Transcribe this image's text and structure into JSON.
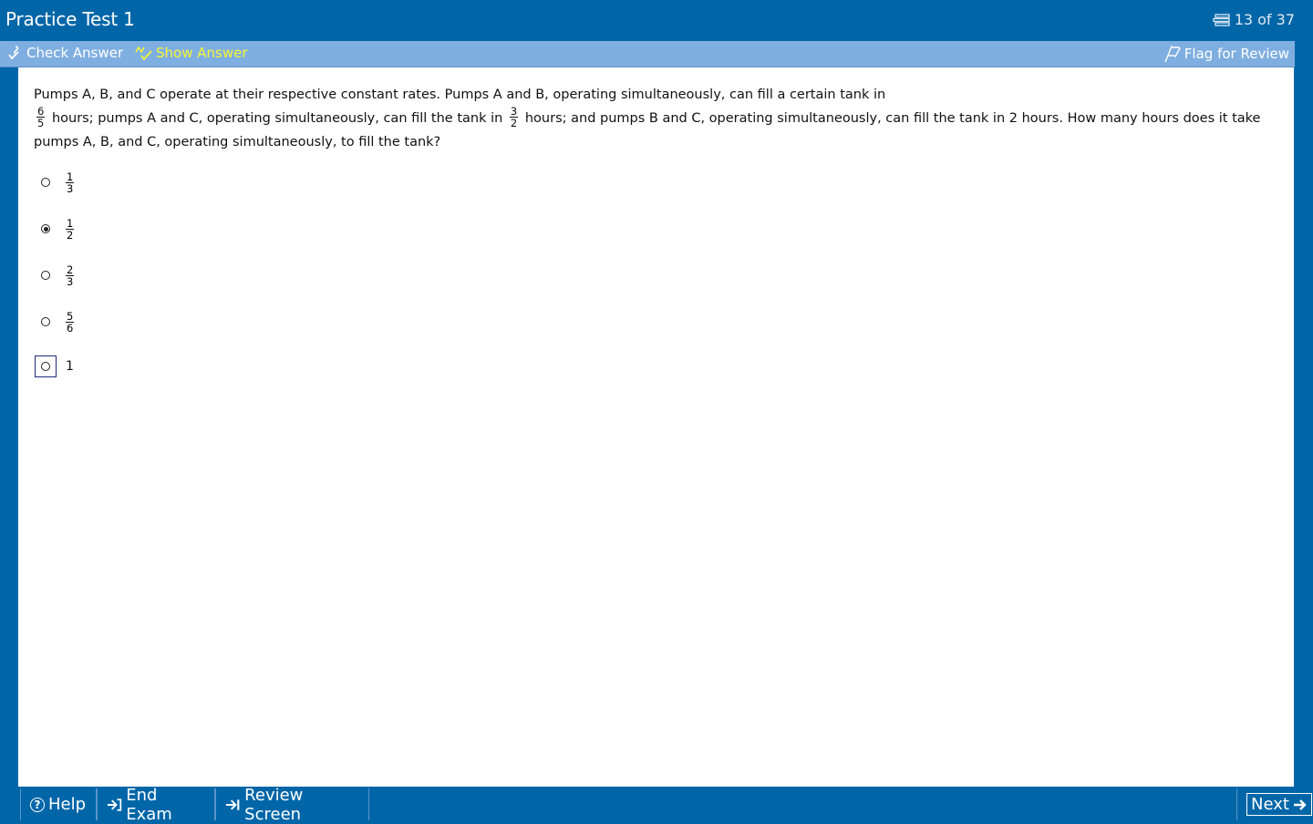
{
  "app": {
    "title": "Practice Test 1",
    "progress": "13 of 37"
  },
  "toolbar": {
    "check_answer": "Check Answer",
    "show_answer": "Show Answer",
    "flag_for_review": "Flag for Review"
  },
  "question": {
    "stem_part1": "Pumps A, B, and C operate at their respective constant rates.  Pumps A and B, operating simultaneously, can fill a certain tank in",
    "frac1_num": "6",
    "frac1_den": "5",
    "stem_part2": "hours; pumps A and C, operating simultaneously, can fill the tank in",
    "frac2_num": "3",
    "frac2_den": "2",
    "stem_part3": "hours; and pumps B and C, operating simultaneously, can fill the tank in 2 hours.  How many hours does it take pumps A, B, and C, operating simultaneously, to fill the tank?"
  },
  "choices": [
    {
      "num": "1",
      "den": "3",
      "selected": false
    },
    {
      "num": "1",
      "den": "2",
      "selected": true
    },
    {
      "num": "2",
      "den": "3",
      "selected": false
    },
    {
      "num": "5",
      "den": "6",
      "selected": false
    },
    {
      "text": "1",
      "selected": false,
      "focused": true
    }
  ],
  "bottom": {
    "help": "Help",
    "end_exam": "End Exam",
    "review_screen": "Review Screen",
    "next": "Next"
  },
  "colors": {
    "frame": "#0066a8",
    "toolbar": "#7faee0",
    "show_answer": "#f5f538"
  }
}
